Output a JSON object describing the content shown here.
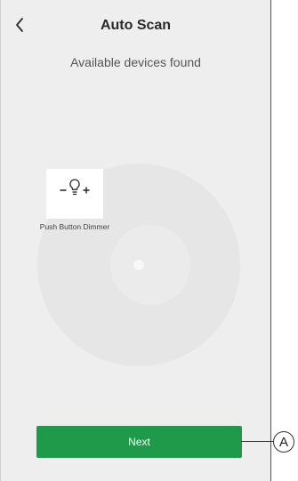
{
  "header": {
    "title": "Auto Scan",
    "back_icon": "chevron-left-icon"
  },
  "subtitle": "Available devices found",
  "devices": [
    {
      "icon": "dimmer-bulb-icon",
      "label": "Push Button Dimmer"
    }
  ],
  "footer": {
    "next_label": "Next"
  },
  "callout": {
    "letter": "A"
  },
  "colors": {
    "background": "#eeeeee",
    "radar_outer": "#e6e6e6",
    "primary_button": "#1f9a4a",
    "button_text": "#ffffff"
  }
}
